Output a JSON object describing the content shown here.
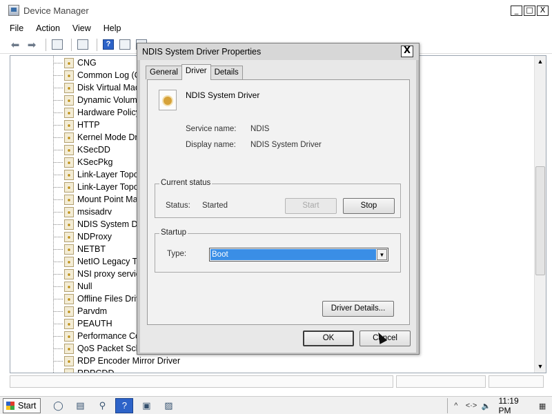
{
  "window": {
    "title": "Device Manager",
    "buttons": [
      "_",
      "□",
      "X"
    ]
  },
  "menu": [
    "File",
    "Action",
    "View",
    "Help"
  ],
  "toolbar": {
    "icons": [
      "back-arrow-icon",
      "forward-arrow-icon",
      "tree-view-icon",
      "properties-icon",
      "help-icon",
      "console-icon",
      "scan-icon"
    ]
  },
  "tree": {
    "items": [
      "CNG",
      "Common Log (CLF",
      "Disk Virtual Machi",
      "Dynamic Volume I",
      "Hardware Policy D",
      "HTTP",
      "Kernel Mode Driv",
      "KSecDD",
      "KSecPkg",
      "Link-Layer Topolo",
      "Link-Layer Topolo",
      "Mount Point Mana",
      "msisadrv",
      "NDIS System Driv",
      "NDProxy",
      "NETBT",
      "NetIO Legacy TDI",
      "NSI proxy service",
      "Null",
      "Offline Files Drive",
      "Parvdm",
      "PEAUTH",
      "Performance Cou",
      "QoS Packet Sched",
      "RDP Encoder Mirror Driver",
      "RDPCDD"
    ]
  },
  "dialog": {
    "title": "NDIS System Driver Properties",
    "close": "X",
    "tabs": [
      "General",
      "Driver",
      "Details"
    ],
    "active_tab": "Driver",
    "driver_name": "NDIS System Driver",
    "service_name_label": "Service name:",
    "service_name": "NDIS",
    "display_name_label": "Display name:",
    "display_name": "NDIS System Driver",
    "current_status_legend": "Current status",
    "status_label": "Status:",
    "status_value": "Started",
    "start_button": "Start",
    "stop_button": "Stop",
    "startup_legend": "Startup",
    "type_label": "Type:",
    "type_value": "Boot",
    "driver_details_button": "Driver Details...",
    "ok_button": "OK",
    "cancel_button": "Cancel"
  },
  "taskbar": {
    "start_label": "Start",
    "clock": "11:19 PM",
    "tray_symbols": [
      "^",
      "<·>",
      "🔈"
    ]
  },
  "colors": {
    "selection": "#3a8ee6",
    "dialog_frame": "#c6c6c6",
    "active_task": "#2d63c8"
  }
}
